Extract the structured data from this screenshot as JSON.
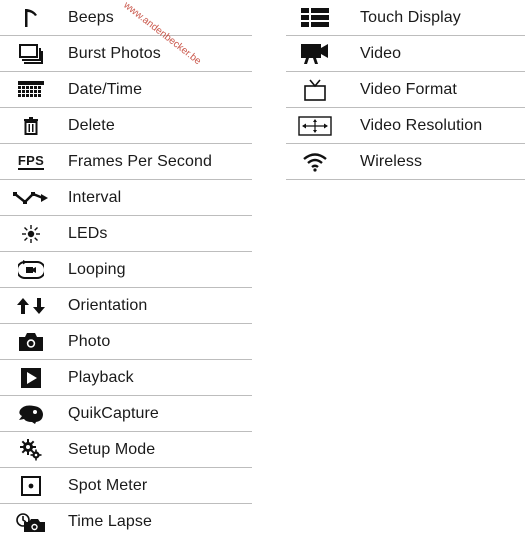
{
  "watermark": "www.andenbecker.be",
  "left": [
    {
      "label": "Beeps",
      "icon": "beeps-icon"
    },
    {
      "label": "Burst Photos",
      "icon": "burst-photos-icon"
    },
    {
      "label": "Date/Time",
      "icon": "date-time-icon"
    },
    {
      "label": "Delete",
      "icon": "delete-icon"
    },
    {
      "label": "Frames Per Second",
      "icon": "fps-icon",
      "icon_text": "FPS"
    },
    {
      "label": "Interval",
      "icon": "interval-icon"
    },
    {
      "label": "LEDs",
      "icon": "leds-icon"
    },
    {
      "label": "Looping",
      "icon": "looping-icon"
    },
    {
      "label": "Orientation",
      "icon": "orientation-icon"
    },
    {
      "label": "Photo",
      "icon": "photo-icon"
    },
    {
      "label": "Playback",
      "icon": "playback-icon"
    },
    {
      "label": "QuikCapture",
      "icon": "quikcapture-icon"
    },
    {
      "label": "Setup Mode",
      "icon": "setup-mode-icon"
    },
    {
      "label": "Spot Meter",
      "icon": "spot-meter-icon"
    },
    {
      "label": "Time Lapse",
      "icon": "time-lapse-icon"
    }
  ],
  "right": [
    {
      "label": "Touch Display",
      "icon": "touch-display-icon"
    },
    {
      "label": "Video",
      "icon": "video-icon"
    },
    {
      "label": "Video Format",
      "icon": "video-format-icon"
    },
    {
      "label": "Video Resolution",
      "icon": "video-resolution-icon"
    },
    {
      "label": "Wireless",
      "icon": "wireless-icon"
    }
  ]
}
